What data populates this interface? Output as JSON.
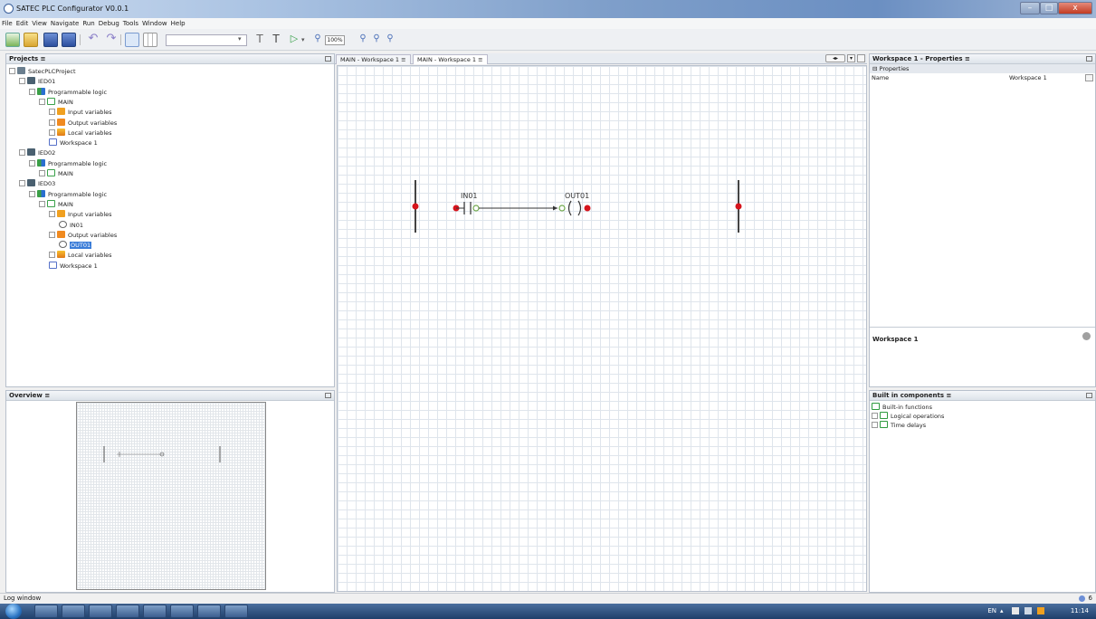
{
  "window": {
    "title": "SATEC PLC Configurator V0.0.1"
  },
  "menu": [
    "File",
    "Edit",
    "View",
    "Navigate",
    "Run",
    "Debug",
    "Tools",
    "Window",
    "Help"
  ],
  "toolbar": {
    "zoom": "100%"
  },
  "projects_panel": {
    "title": "Projects",
    "tree": [
      {
        "label": "SatecPLCProject",
        "icon": "project-icon",
        "depth": 0
      },
      {
        "label": "IED01",
        "icon": "ied-icon",
        "depth": 1
      },
      {
        "label": "Programmable logic",
        "icon": "logic-icon",
        "depth": 2
      },
      {
        "label": "MAIN",
        "icon": "main-icon",
        "depth": 3
      },
      {
        "label": "Input variables",
        "icon": "input-variables-icon",
        "depth": 4
      },
      {
        "label": "Output variables",
        "icon": "output-variables-icon",
        "depth": 4
      },
      {
        "label": "Local variables",
        "icon": "local-variables-icon",
        "depth": 4
      },
      {
        "label": "Workspace 1",
        "icon": "workspace-icon",
        "depth": 4
      },
      {
        "label": "IED02",
        "icon": "ied-icon",
        "depth": 1
      },
      {
        "label": "Programmable logic",
        "icon": "logic-icon",
        "depth": 2
      },
      {
        "label": "MAIN",
        "icon": "main-icon",
        "depth": 3
      },
      {
        "label": "IED03",
        "icon": "ied-icon",
        "depth": 1
      },
      {
        "label": "Programmable logic",
        "icon": "logic-icon",
        "depth": 2
      },
      {
        "label": "MAIN",
        "icon": "main-icon",
        "depth": 3
      },
      {
        "label": "Input variables",
        "icon": "input-variables-icon",
        "depth": 4
      },
      {
        "label": "IN01",
        "icon": "variable-icon",
        "depth": 5
      },
      {
        "label": "Output variables",
        "icon": "output-variables-icon",
        "depth": 4
      },
      {
        "label": "OUT01",
        "icon": "variable-icon",
        "depth": 5,
        "selected": true
      },
      {
        "label": "Local variables",
        "icon": "local-variables-icon",
        "depth": 4
      },
      {
        "label": "Workspace 1",
        "icon": "workspace-icon",
        "depth": 4
      }
    ]
  },
  "overview_panel": {
    "title": "Overview"
  },
  "editor": {
    "tabs": [
      "MAIN - Workspace 1",
      "MAIN - Workspace 1"
    ],
    "diagram": {
      "contact_label": "IN01",
      "coil_label": "OUT01"
    }
  },
  "properties_panel": {
    "title": "Workspace 1 - Properties",
    "section": "Properties",
    "rows": [
      {
        "name": "Name",
        "value": "Workspace 1"
      }
    ],
    "description_title": "Workspace 1"
  },
  "components_panel": {
    "title": "Built in components",
    "items": [
      "Built-in functions",
      "Logical operations",
      "Time delays"
    ]
  },
  "status": {
    "log_window": "Log window",
    "corner": "6"
  },
  "taskbar": {
    "lang": "EN",
    "clock": "11:14"
  },
  "colors": {
    "selection": "#3b7dd8",
    "terminal_red": "#d6141c",
    "contact_green": "#6fa84a"
  }
}
